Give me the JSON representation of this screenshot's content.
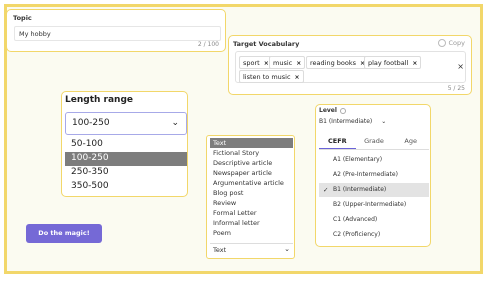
{
  "topic": {
    "label": "Topic",
    "value": "My hobby",
    "counter": "2 / 100"
  },
  "vocab": {
    "label": "Target Vocabulary",
    "copy_label": "Copy",
    "chips": [
      "sport",
      "music",
      "reading books",
      "play football",
      "listen to music"
    ],
    "counter": "5 / 25"
  },
  "length": {
    "label": "Length range",
    "selected": "100-250",
    "options": [
      "50-100",
      "100-250",
      "250-350",
      "350-500"
    ]
  },
  "text_type": {
    "options": [
      "Text",
      "Fictional Story",
      "Descriptive article",
      "Newspaper article",
      "Argumentative article",
      "Blog post",
      "Review",
      "Formal Letter",
      "Informal letter",
      "Poem"
    ],
    "selected": "Text"
  },
  "level": {
    "label": "Level",
    "selected": "B1 (Intermediate)",
    "tabs": [
      "CEFR",
      "Grade",
      "Age"
    ],
    "items": [
      "A1 (Elementary)",
      "A2 (Pre-Intermediate)",
      "B1 (Intermediate)",
      "B2 (Upper-Intermediate)",
      "C1 (Advanced)",
      "C2 (Proficiency)"
    ]
  },
  "magic_button": "Do the magic!",
  "colors": {
    "accent": "#7569d6",
    "border_yellow": "#f2d76a",
    "selected_gray": "#7d7d7d"
  }
}
